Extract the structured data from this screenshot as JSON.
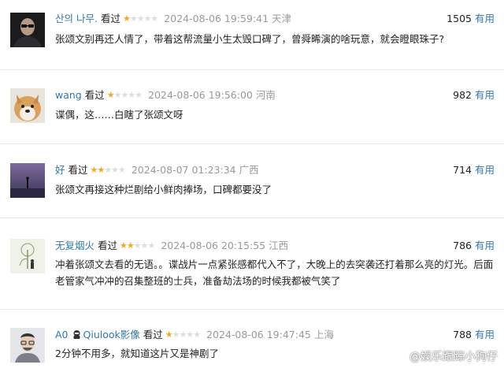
{
  "comments": [
    {
      "user": "산의 나무.",
      "status": "看过",
      "rating": 1,
      "time": "2024-08-06 19:59:41",
      "location": "天津",
      "votes": "1505",
      "useful": "有用",
      "text": "张颂文别再还人情了，带着这帮流量小生太毁口碑了，曾舜晞演的啥玩意，就会瞪眼珠子?"
    },
    {
      "user": "wang",
      "status": "看过",
      "rating": 1,
      "time": "2024-08-06 19:56:00",
      "location": "河南",
      "votes": "982",
      "useful": "有用",
      "text": "谍偶，这……白瞎了张颂文呀"
    },
    {
      "user": "好",
      "status": "看过",
      "rating": 2,
      "time": "2024-08-07 01:23:34",
      "location": "广西",
      "votes": "714",
      "useful": "有用",
      "text": "张颂文再接这种烂剧给小鲜肉捧场，口碑都要没了"
    },
    {
      "user": "无复烟火",
      "status": "看过",
      "rating": 2,
      "time": "2024-08-06 20:15:55",
      "location": "江西",
      "votes": "786",
      "useful": "有用",
      "text": "冲着张颂文去看的无语。。谍战片一点紧张感都代入不了，大晚上的去突袭还打着那么亮的灯光。后面老管家气冲冲的召集整班的士兵，准备劫法场的时候我都被气笑了"
    },
    {
      "user": "A0",
      "badge": "Qiulook影像",
      "status": "看过",
      "rating": 1,
      "time": "2024-08-06 19:47:45",
      "location": "上海",
      "votes": "788",
      "useful": "有用",
      "text": "2分钟不用多，就知道这片又是神剧了"
    }
  ],
  "watermark": "@娱乐跟踪小狗仔",
  "colors": {
    "link": "#3377aa",
    "star": "#f5a623",
    "muted": "#9a9a9a"
  }
}
